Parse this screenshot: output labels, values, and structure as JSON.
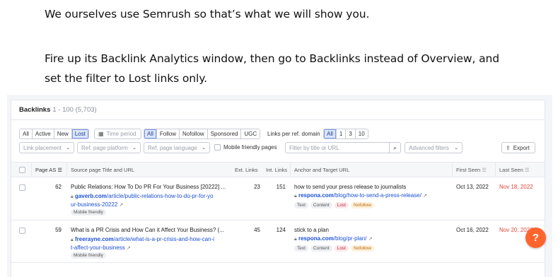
{
  "article": {
    "line1": "We ourselves use Semrush so that’s what we will show you.",
    "line2": "Fire up its Backlink Analytics window, then go to Backlinks instead of Overview, and set the filter to Lost links only."
  },
  "backlinks": {
    "title": "Backlinks",
    "count": "1 - 100 (5,703)",
    "status_tabs": [
      "All",
      "Active",
      "New",
      "Lost"
    ],
    "status_selected": "Lost",
    "time_period": "Time period",
    "type_tabs": [
      "All",
      "Follow",
      "Nofollow",
      "Sponsored",
      "UGC"
    ],
    "type_selected": "All",
    "per_domain_label": "Links per ref. domain",
    "per_domain_tabs": [
      "All",
      "1",
      "3",
      "10"
    ],
    "per_domain_selected": "All",
    "filters": {
      "link_placement": "Link placement",
      "ref_page_platform": "Ref. page platform",
      "ref_page_language": "Ref. page language",
      "mobile_friendly": "Mobile friendly pages",
      "search_placeholder": "Filter by title or URL",
      "advanced": "Advanced filters",
      "export": "Export"
    },
    "columns": {
      "page_as": "Page AS",
      "source": "Source page Title and URL",
      "ext_links": "Ext. Links",
      "int_links": "Int. Links",
      "anchor": "Anchor and Target URL",
      "first_seen": "First Seen",
      "last_seen": "Last Seen"
    },
    "rows": [
      {
        "page_as": "62",
        "title": "Public Relations: How To Do PR For Your Business [20222] ...",
        "domain": "gaverb.com",
        "path1": "/article/public-relations-how-to-do-pr-for-yo",
        "path2": "ur-business-20222",
        "badge": "Mobile friendly",
        "ext_links": "23",
        "int_links": "151",
        "anchor": "how to send your press release to journalists",
        "target_domain": "respona.com",
        "target_path": "/blog/how-to-send-a-press-release/",
        "tags": [
          "Text",
          "Content",
          "Lost",
          "Nofollow"
        ],
        "first_seen": "Oct 13, 2022",
        "last_seen": "Nov 18, 2022"
      },
      {
        "page_as": "59",
        "title": "What is a PR Crisis and How Can it Affect Your Business? (...",
        "domain": "freerayne.com",
        "path1": "/article/what-is-a-pr-crisis-and-how-can-i",
        "path2": "t-affect-your-business",
        "badge": "Mobile friendly",
        "ext_links": "45",
        "int_links": "124",
        "anchor": "stick to a plan",
        "target_domain": "respona.com",
        "target_path": "/blog/pr-plan/",
        "tags": [
          "Text",
          "Content",
          "Lost",
          "Nofollow"
        ],
        "first_seen": "Oct 16, 2022",
        "last_seen": "Nov 20, 2022"
      }
    ],
    "help": "?"
  },
  "colors": {
    "accent": "#1a4fd6",
    "lost": "#e0453b",
    "help": "#ff642d"
  }
}
